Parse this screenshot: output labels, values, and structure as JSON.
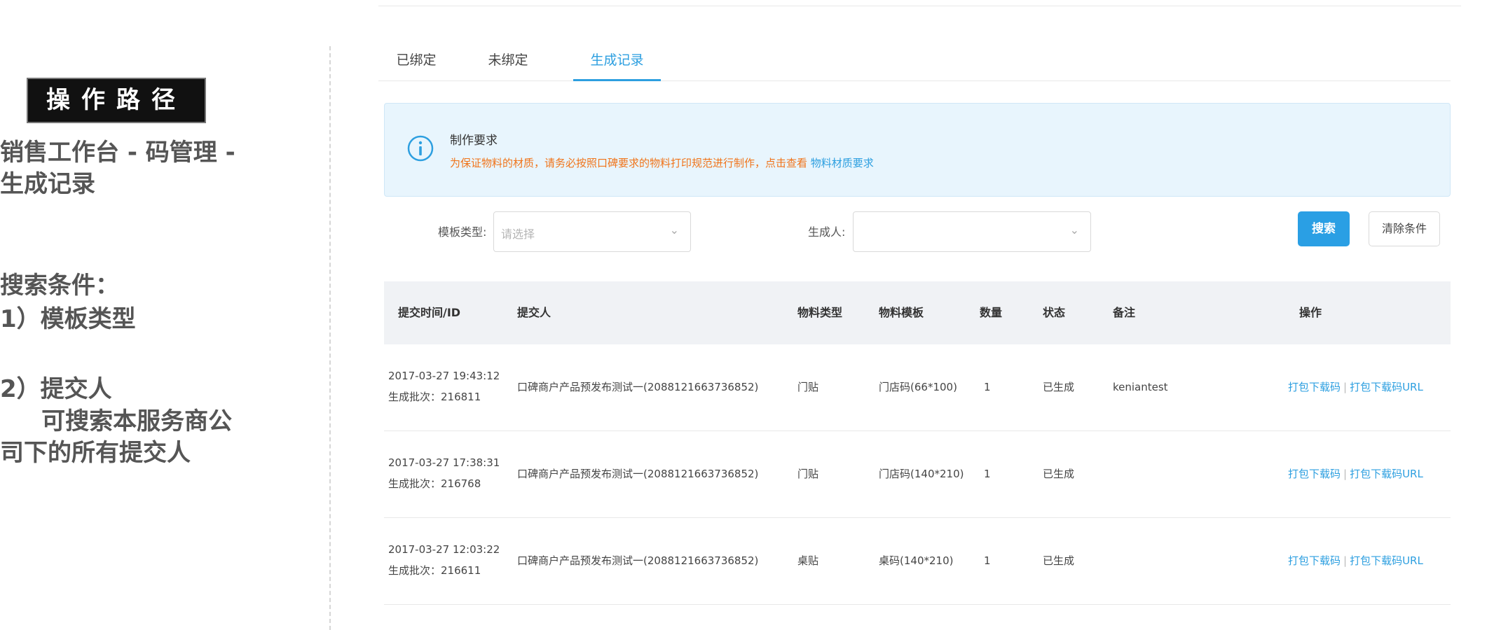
{
  "side": {
    "badge": "操作路径",
    "path": "销售工作台 - 码管理 -\n生成记录",
    "search_title": "搜索条件：",
    "cond1": "1）模板类型",
    "cond2": "2）提交人",
    "cond2_note": "     可搜索本服务商公\n司下的所有提交人"
  },
  "tabs": [
    {
      "label": "已绑定",
      "active": false
    },
    {
      "label": "未绑定",
      "active": false
    },
    {
      "label": "生成记录",
      "active": true
    }
  ],
  "notice": {
    "title": "制作要求",
    "message": "为保证物料的材质，请务必按照口碑要求的物料打印规范进行制作，点击查看",
    "link": "物料材质要求",
    "icon": "info-icon"
  },
  "filters": {
    "template_label": "模板类型:",
    "template_placeholder": "请选择",
    "creator_label": "生成人:",
    "creator_placeholder": "",
    "search_button": "搜索",
    "clear_button": "清除条件"
  },
  "table": {
    "headers": [
      "提交时间/ID",
      "提交人",
      "物料类型",
      "物料模板",
      "数量",
      "状态",
      "备注",
      "操作"
    ],
    "rows": [
      {
        "time": "2017-03-27 19:43:12",
        "batch": "生成批次：216811",
        "submitter": "口碑商户产品预发布测试一(2088121663736852)",
        "type": "门贴",
        "template": "门店码(66*100)",
        "qty": "1",
        "status": "已生成",
        "note": "keniantest",
        "op1": "打包下载码",
        "op2": "打包下载码URL"
      },
      {
        "time": "2017-03-27 17:38:31",
        "batch": "生成批次：216768",
        "submitter": "口碑商户产品预发布测试一(2088121663736852)",
        "type": "门贴",
        "template": "门店码(140*210)",
        "qty": "1",
        "status": "已生成",
        "note": "",
        "op1": "打包下载码",
        "op2": "打包下载码URL"
      },
      {
        "time": "2017-03-27 12:03:22",
        "batch": "生成批次：216611",
        "submitter": "口碑商户产品预发布测试一(2088121663736852)",
        "type": "桌贴",
        "template": "桌码(140*210)",
        "qty": "1",
        "status": "已生成",
        "note": "",
        "op1": "打包下载码",
        "op2": "打包下载码URL"
      }
    ]
  },
  "colors": {
    "accent": "#2d9fe0",
    "warning_text": "#f0741a",
    "notice_bg": "#e8f5fd"
  }
}
